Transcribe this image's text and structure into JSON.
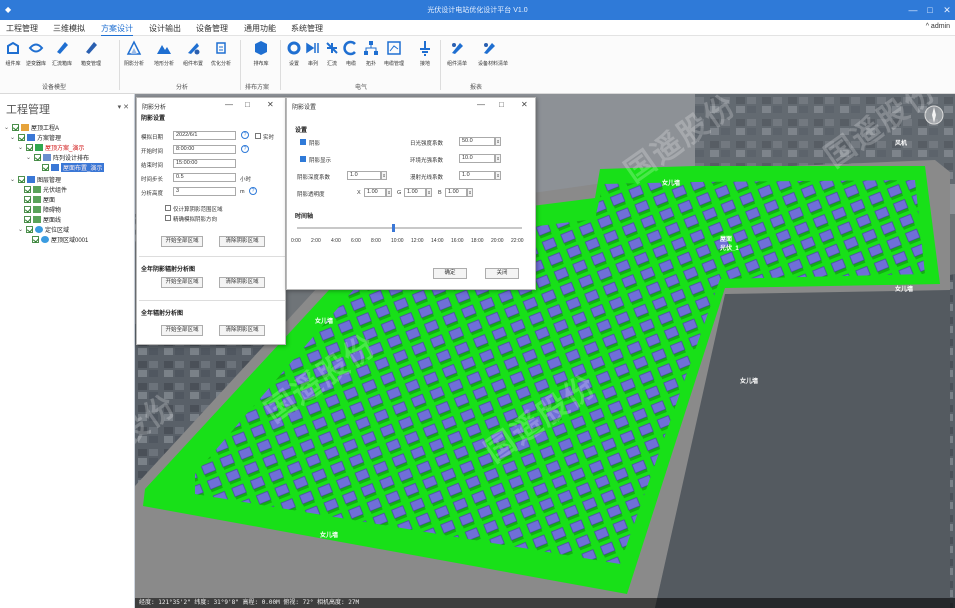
{
  "window": {
    "title": "光伏设计电站优化设计平台 V1.0",
    "controls": [
      "—",
      "□",
      "✕"
    ]
  },
  "menu": {
    "items": [
      "工程管理",
      "三维模拟",
      "方案设计",
      "设计输出",
      "设备管理",
      "通用功能",
      "系统管理"
    ],
    "active_index": 2,
    "user": "admin"
  },
  "ribbon": {
    "groups": [
      {
        "label": "设备模型",
        "tools": [
          "组件库",
          "逆变器库",
          "汇流箱库",
          "箱变管理"
        ]
      },
      {
        "label": "分析",
        "tools": [
          "阴影分析",
          "地形分析",
          "组件布置",
          "优化分析"
        ]
      },
      {
        "label": "排布方案",
        "tools": [
          "排布库"
        ]
      },
      {
        "label": "电气",
        "tools": [
          "设置",
          "串列",
          "汇流",
          "电缆",
          "拓扑",
          "电缆管理",
          "接地"
        ]
      },
      {
        "label": "报表",
        "tools": [
          "组件清单",
          "设备材料清单"
        ]
      }
    ]
  },
  "project_panel": {
    "title": "工程管理",
    "pin": "▾ ✕",
    "tree": [
      {
        "text": "屋顶工程A",
        "level": 0,
        "red": false
      },
      {
        "text": "方案管理",
        "level": 1,
        "red": false
      },
      {
        "text": "屋顶方案_演示",
        "level": 2,
        "red": true
      },
      {
        "text": "阵列设计排布",
        "level": 3,
        "red": false
      },
      {
        "text": "屋面布置_演示",
        "level": 4,
        "red": true,
        "selected": true
      },
      {
        "text": "图层管理",
        "level": 1,
        "red": false
      },
      {
        "text": "光伏组件",
        "level": 2,
        "red": false
      },
      {
        "text": "屋面",
        "level": 2,
        "red": false
      },
      {
        "text": "障碍物",
        "level": 2,
        "red": false
      },
      {
        "text": "屋面线",
        "level": 2,
        "red": false
      },
      {
        "text": "定位区域",
        "level": 2,
        "red": false
      },
      {
        "text": "屋顶区域0001",
        "level": 3,
        "red": false
      }
    ]
  },
  "shadow_dialog": {
    "title": "阴影分析",
    "section1": "阴影设置",
    "fields": [
      {
        "label": "模拟日期",
        "value": "2022/6/1"
      },
      {
        "label": "开始时间",
        "value": "8:00:00"
      },
      {
        "label": "结束时间",
        "value": "15:00:00"
      },
      {
        "label": "时间步长",
        "value": "0.5",
        "unit": "小时"
      },
      {
        "label": "分析高度",
        "value": "3",
        "unit": "m"
      }
    ],
    "live_label": "实时",
    "checks": [
      "仅计算阴影范围区域",
      "精确模拟阴影方向"
    ],
    "btn_start": "开始全部区域",
    "btn_clear": "清除阴影区域",
    "section2": "全年阴影辐射分析图",
    "btn2a": "开始全部区域",
    "btn2b": "清除阴影区域",
    "section3": "全年辐射分析图",
    "btn3a": "开始全部区域",
    "btn3b": "清除阴影区域"
  },
  "settings_dialog": {
    "title": "阴影设置",
    "section": "设置",
    "left": [
      {
        "label": "阴影",
        "checked": true
      },
      {
        "label": "阴影显示",
        "checked": true
      }
    ],
    "row_labels": [
      "阴影深度系数",
      "阴影透明度"
    ],
    "row_values": [
      "1.0"
    ],
    "xyz": [
      {
        "axis": "X",
        "value": "1.00"
      },
      {
        "axis": "G",
        "value": "1.00"
      },
      {
        "axis": "B",
        "value": "1.00"
      }
    ],
    "right": [
      {
        "label": "日光强度系数",
        "value": "50.0"
      },
      {
        "label": "环境光强系数",
        "value": "10.0"
      },
      {
        "label": "漫射光线系数",
        "value": "1.0"
      }
    ],
    "time_section": "时间轴",
    "ticks": [
      "0:00",
      "2:00",
      "4:00",
      "6:00",
      "8:00",
      "10:00",
      "12:00",
      "14:00",
      "16:00",
      "18:00",
      "20:00",
      "22:00"
    ],
    "slider_fraction": 0.42,
    "ok": "确定",
    "close": "关闭"
  },
  "viewport": {
    "watermark": "国遥股份",
    "roof_labels": [
      "女儿墙",
      "女儿墙",
      "女儿墙",
      "女儿墙",
      "风机",
      "屋面\n光伏_1"
    ],
    "status": "经度: 121°35'2\"  纬度: 31°9'8\"  高程: 0.00M  俯视: 72°  相机高度: 27M",
    "colors": {
      "roof": "#18e018",
      "panel": "#6f6fd8",
      "wall": "#7c7c7c"
    }
  }
}
